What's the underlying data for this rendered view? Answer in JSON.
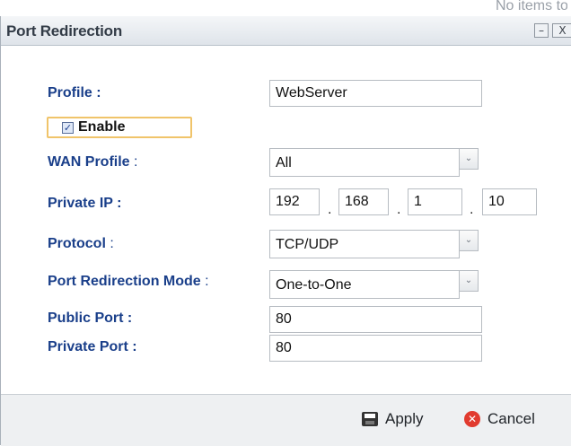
{
  "background": {
    "text": "No items to show"
  },
  "window": {
    "title": "Port Redirection",
    "minimize_glyph": "–",
    "close_glyph": "X"
  },
  "form": {
    "profile": {
      "label": "Profile :",
      "value": "WebServer"
    },
    "enable": {
      "label": "Enable",
      "checked": true,
      "check_glyph": "✓"
    },
    "wan_profile": {
      "label": "WAN Profile",
      "label_suffix": " :",
      "value": "All"
    },
    "private_ip": {
      "label": "Private IP :",
      "octets": [
        "192",
        "168",
        "1",
        "10"
      ],
      "separator": "."
    },
    "protocol": {
      "label": "Protocol",
      "label_suffix": " :",
      "value": "TCP/UDP"
    },
    "mode": {
      "label": "Port Redirection Mode",
      "label_suffix": " :",
      "value": "One-to-One"
    },
    "public_port": {
      "label": "Public Port :",
      "value": "80"
    },
    "private_port": {
      "label": "Private Port :",
      "value": "80"
    }
  },
  "select_arrow_glyph": "⌄",
  "footer": {
    "apply_label": "Apply",
    "cancel_label": "Cancel",
    "apply_icon": "save-icon",
    "cancel_icon": "cancel-icon"
  },
  "colors": {
    "label": "#1a3f8a",
    "enable_highlight": "#f0c46a",
    "footer_bg": "#eef0f2",
    "cancel": "#e13b2f"
  }
}
